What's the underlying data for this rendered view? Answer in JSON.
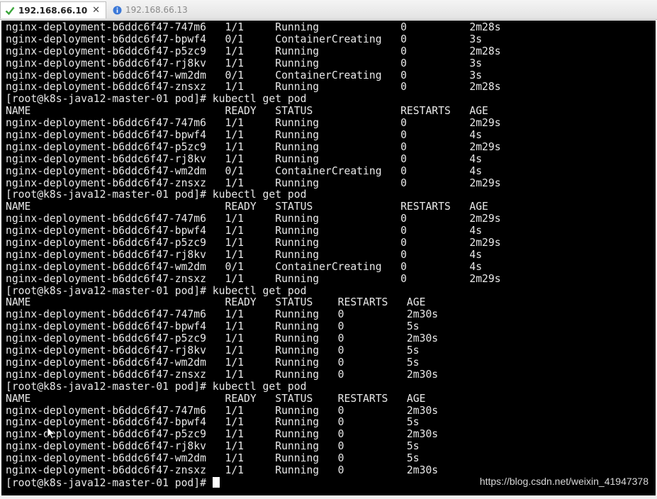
{
  "tabs": [
    {
      "label": "192.168.66.10",
      "active": true,
      "icon": "check-icon",
      "close": "✕"
    },
    {
      "label": "192.168.66.13",
      "active": false,
      "icon": "info-icon"
    }
  ],
  "colors": {
    "terminal_bg": "#000000",
    "terminal_fg": "#e8e8e8",
    "check_green": "#3aa53a",
    "info_blue": "#3b78d8"
  },
  "terminal": {
    "lines": [
      "nginx-deployment-b6ddc6f47-747m6   1/1     Running             0          2m28s",
      "nginx-deployment-b6ddc6f47-bpwf4   0/1     ContainerCreating   0          3s",
      "nginx-deployment-b6ddc6f47-p5zc9   1/1     Running             0          2m28s",
      "nginx-deployment-b6ddc6f47-rj8kv   1/1     Running             0          3s",
      "nginx-deployment-b6ddc6f47-wm2dm   0/1     ContainerCreating   0          3s",
      "nginx-deployment-b6ddc6f47-znsxz   1/1     Running             0          2m28s",
      "[root@k8s-java12-master-01 pod]# kubectl get pod",
      "NAME                               READY   STATUS              RESTARTS   AGE",
      "nginx-deployment-b6ddc6f47-747m6   1/1     Running             0          2m29s",
      "nginx-deployment-b6ddc6f47-bpwf4   1/1     Running             0          4s",
      "nginx-deployment-b6ddc6f47-p5zc9   1/1     Running             0          2m29s",
      "nginx-deployment-b6ddc6f47-rj8kv   1/1     Running             0          4s",
      "nginx-deployment-b6ddc6f47-wm2dm   0/1     ContainerCreating   0          4s",
      "nginx-deployment-b6ddc6f47-znsxz   1/1     Running             0          2m29s",
      "[root@k8s-java12-master-01 pod]# kubectl get pod",
      "NAME                               READY   STATUS              RESTARTS   AGE",
      "nginx-deployment-b6ddc6f47-747m6   1/1     Running             0          2m29s",
      "nginx-deployment-b6ddc6f47-bpwf4   1/1     Running             0          4s",
      "nginx-deployment-b6ddc6f47-p5zc9   1/1     Running             0          2m29s",
      "nginx-deployment-b6ddc6f47-rj8kv   1/1     Running             0          4s",
      "nginx-deployment-b6ddc6f47-wm2dm   0/1     ContainerCreating   0          4s",
      "nginx-deployment-b6ddc6f47-znsxz   1/1     Running             0          2m29s",
      "[root@k8s-java12-master-01 pod]# kubectl get pod",
      "NAME                               READY   STATUS    RESTARTS   AGE",
      "nginx-deployment-b6ddc6f47-747m6   1/1     Running   0          2m30s",
      "nginx-deployment-b6ddc6f47-bpwf4   1/1     Running   0          5s",
      "nginx-deployment-b6ddc6f47-p5zc9   1/1     Running   0          2m30s",
      "nginx-deployment-b6ddc6f47-rj8kv   1/1     Running   0          5s",
      "nginx-deployment-b6ddc6f47-wm2dm   1/1     Running   0          5s",
      "nginx-deployment-b6ddc6f47-znsxz   1/1     Running   0          2m30s",
      "[root@k8s-java12-master-01 pod]# kubectl get pod",
      "NAME                               READY   STATUS    RESTARTS   AGE",
      "nginx-deployment-b6ddc6f47-747m6   1/1     Running   0          2m30s",
      "nginx-deployment-b6ddc6f47-bpwf4   1/1     Running   0          5s",
      "nginx-deployment-b6ddc6f47-p5zc9   1/1     Running   0          2m30s",
      "nginx-deployment-b6ddc6f47-rj8kv   1/1     Running   0          5s",
      "nginx-deployment-b6ddc6f47-wm2dm   1/1     Running   0          5s",
      "nginx-deployment-b6ddc6f47-znsxz   1/1     Running   0          2m30s"
    ],
    "prompt": "[root@k8s-java12-master-01 pod]# "
  },
  "watermark": "https://blog.csdn.net/weixin_41947378"
}
